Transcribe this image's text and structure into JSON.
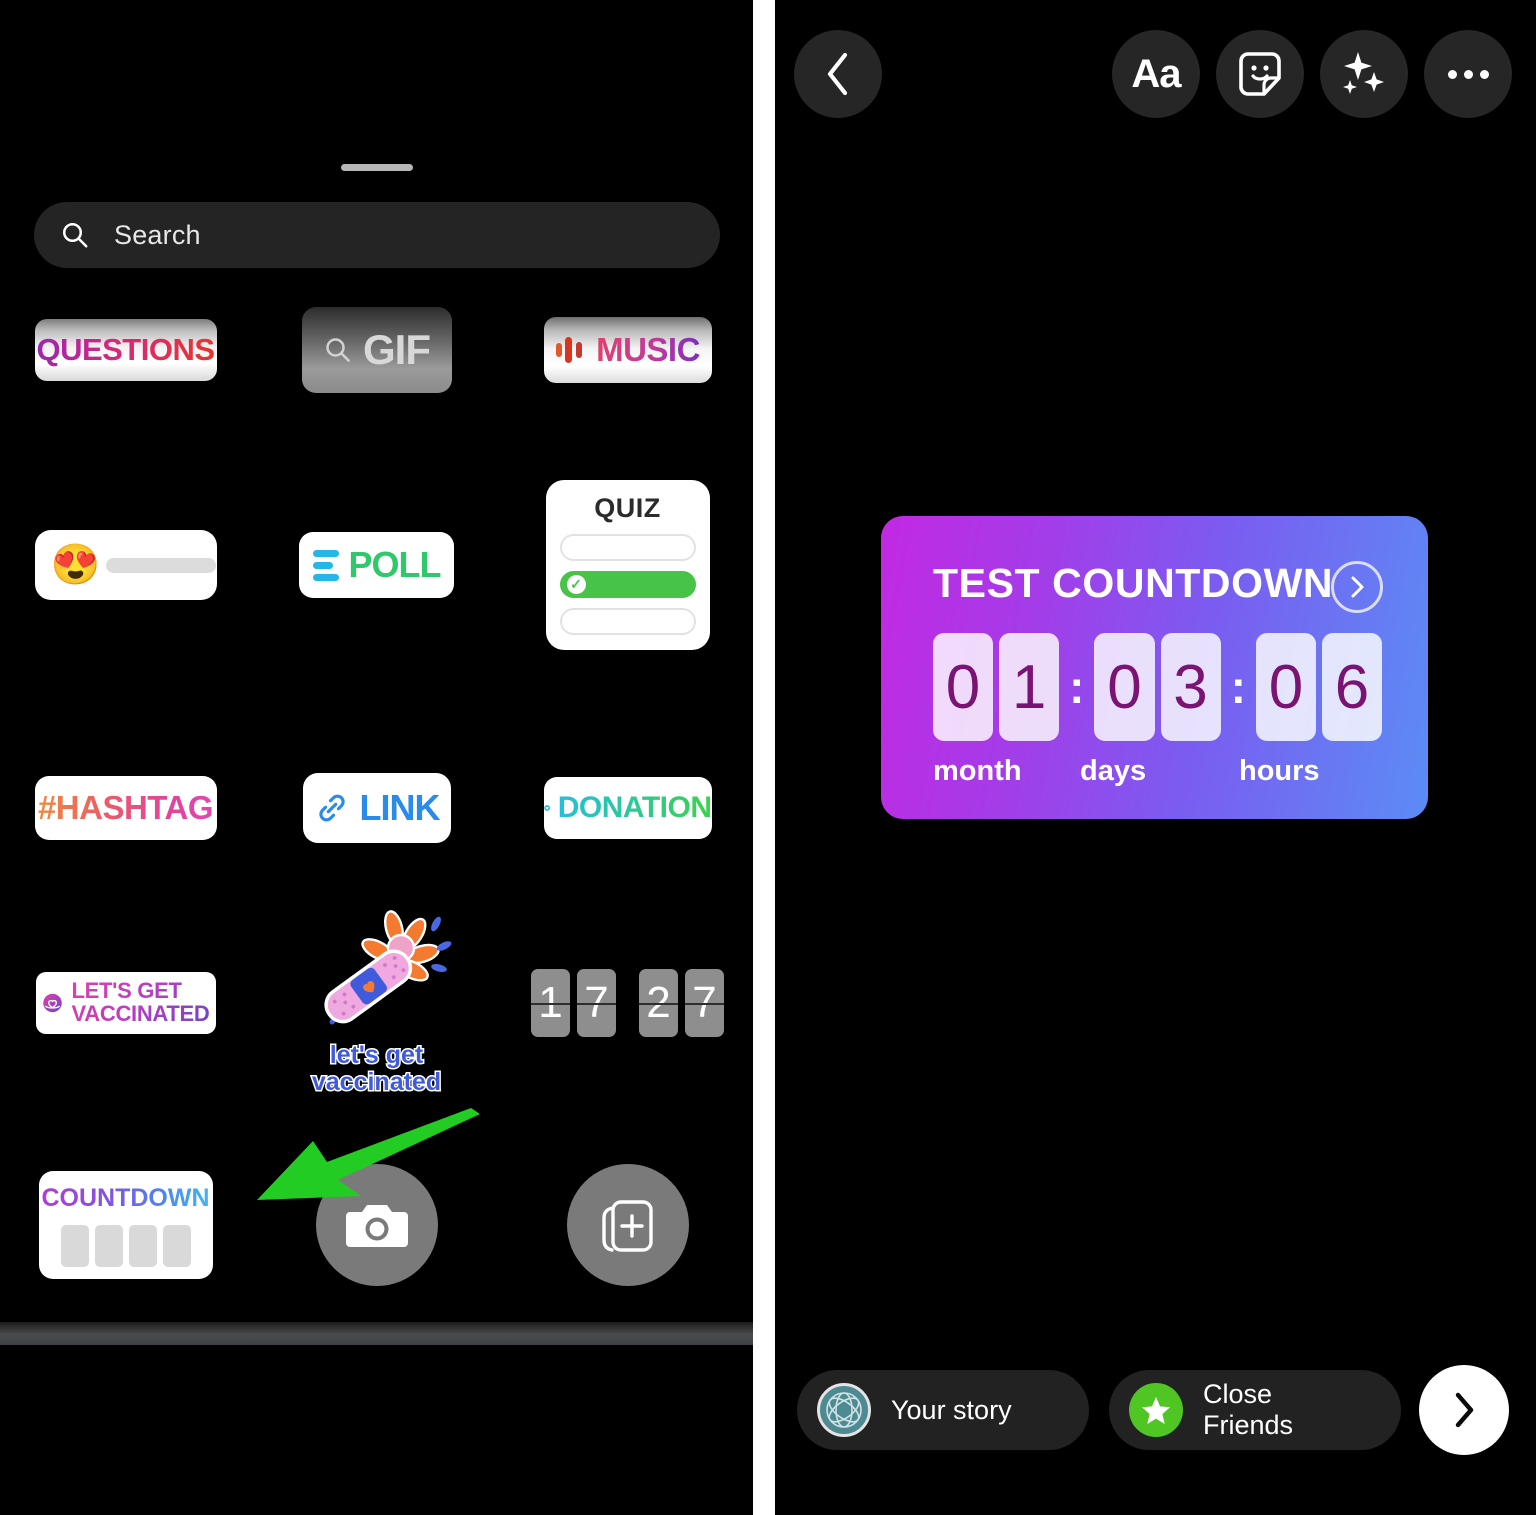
{
  "app": {
    "name": "Instagram Story Composer",
    "divider_color": "#ffffff",
    "background": "#000000"
  },
  "left_panel": {
    "name": "sticker-tray-sheet",
    "grabber": "drag-handle",
    "search": {
      "placeholder": "Search",
      "icon": "search-icon",
      "value": ""
    },
    "stickers": [
      [
        {
          "id": "questions",
          "label": "QUESTIONS",
          "icon": ""
        },
        {
          "id": "gif",
          "label": "GIF",
          "icon": "search-icon"
        },
        {
          "id": "music",
          "label": "MUSIC",
          "icon": "music-bars-icon"
        }
      ],
      [
        {
          "id": "slider",
          "label": "",
          "icon": "heart-eyes-emoji",
          "emoji": "😍"
        },
        {
          "id": "poll",
          "label": "POLL",
          "icon": "poll-bars-icon"
        },
        {
          "id": "quiz",
          "label": "QUIZ",
          "icon": "",
          "options": [
            "",
            "",
            ""
          ],
          "correct_index": 1
        }
      ],
      [
        {
          "id": "hashtag",
          "label": "#HASHTAG",
          "icon": ""
        },
        {
          "id": "link",
          "label": "LINK",
          "icon": "link-chain-icon"
        },
        {
          "id": "donation",
          "label": "DONATION",
          "icon": "heart-shield-icon"
        }
      ],
      [
        {
          "id": "lets-get-vaccinated",
          "label": "LET'S GET\nVACCINATED",
          "line1": "LET'S GET",
          "line2": "VACCINATED",
          "icon": "vaccine-heart-ribbon-icon"
        },
        {
          "id": "vaccinated-art",
          "label": "let's get\nvaccinated",
          "line1": "let's get",
          "line2": "vaccinated",
          "icon": "bandage-flower-icon"
        },
        {
          "id": "flip-clock",
          "label": "",
          "digits": [
            "1",
            "7",
            "2",
            "7"
          ],
          "icon": "flip-clock-icon"
        }
      ]
    ],
    "countdown_sticker": {
      "label": "COUNTDOWN",
      "slot_count": 4
    },
    "camera_button": {
      "label": "",
      "icon": "camera-icon"
    },
    "gallery_button": {
      "label": "",
      "icon": "add-photo-icon"
    },
    "annotation": {
      "type": "arrow",
      "color": "#22cc22",
      "points_to": "countdown-sticker"
    }
  },
  "right_panel": {
    "name": "story-composer",
    "toolbar": [
      {
        "id": "back",
        "label": "",
        "icon": "chevron-left-icon"
      },
      {
        "id": "text",
        "label": "Aa",
        "icon": "text-icon"
      },
      {
        "id": "sticker",
        "label": "",
        "icon": "sticker-smiley-icon"
      },
      {
        "id": "effects",
        "label": "",
        "icon": "sparkles-icon"
      },
      {
        "id": "more",
        "label": "",
        "icon": "more-dots-icon"
      }
    ],
    "countdown": {
      "title": "TEST COUNTDOWN",
      "chevron_icon": "chevron-right-circle-icon",
      "groups": [
        {
          "name": "month",
          "digits": [
            "0",
            "1"
          ]
        },
        {
          "name": "days",
          "digits": [
            "0",
            "3"
          ]
        },
        {
          "name": "hours",
          "digits": [
            "0",
            "6"
          ]
        }
      ],
      "separator": ":",
      "labels": {
        "month": "month",
        "days": "days",
        "hours": "hours"
      },
      "gradient_from": "#c229e2",
      "gradient_to": "#5b8cf5",
      "digit_color": "#7a1473"
    },
    "share": {
      "your_story": {
        "label": "Your story",
        "icon": "avatar-icon"
      },
      "close_friends": {
        "label": "Close Friends",
        "icon": "green-star-icon",
        "color": "#4fc623"
      },
      "next": {
        "label": "",
        "icon": "chevron-right-icon"
      }
    }
  }
}
